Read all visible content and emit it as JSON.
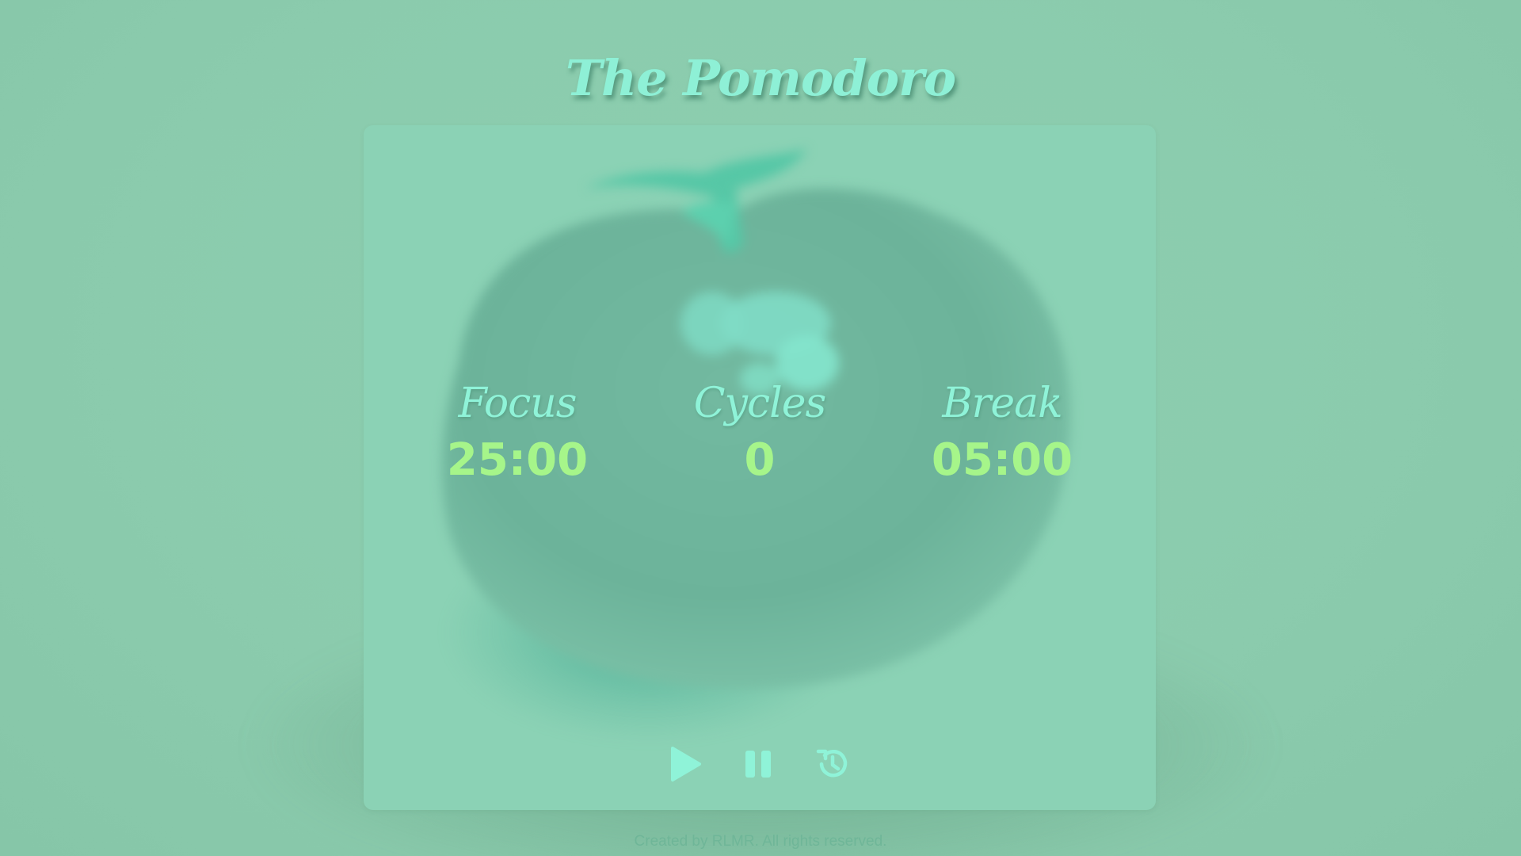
{
  "app": {
    "title": "The Pomodoro"
  },
  "timer": {
    "focus": {
      "label": "Focus",
      "value": "25:00"
    },
    "cycles": {
      "label": "Cycles",
      "value": "0"
    },
    "break": {
      "label": "Break",
      "value": "05:00"
    }
  },
  "controls": {
    "play_icon": "play-icon",
    "pause_icon": "pause-icon",
    "reset_icon": "history-reset-icon"
  },
  "footer": {
    "text": "Created by RLMR. All rights reserved."
  },
  "colors": {
    "background": "#8bcbad",
    "card": "#8bd2b5",
    "title": "#8ef0d6",
    "label": "#8ff3d8",
    "value": "#a6f58a",
    "icon": "#8ff3d8",
    "footer": "#6fb698"
  }
}
